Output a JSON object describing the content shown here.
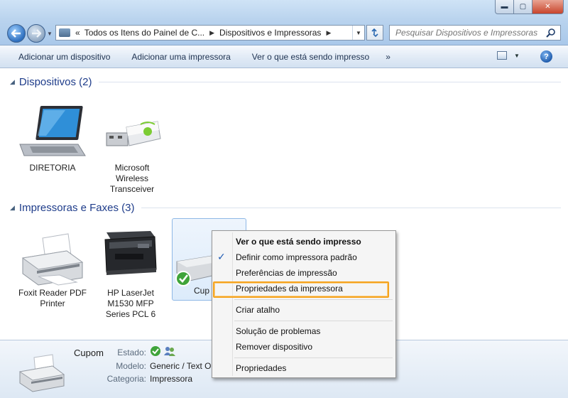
{
  "window": {
    "controls": {
      "minimize": "▬",
      "maximize": "▢",
      "close": "✕"
    }
  },
  "address_bar": {
    "prefix": "«",
    "crumbs": [
      "Todos os Itens do Painel de C...",
      "Dispositivos e Impressoras"
    ]
  },
  "search": {
    "placeholder": "Pesquisar Dispositivos e Impressoras"
  },
  "command_bar": {
    "items": [
      "Adicionar um dispositivo",
      "Adicionar uma impressora",
      "Ver o que está sendo impresso"
    ],
    "more": "»",
    "help": "?"
  },
  "groups": {
    "devices": {
      "title": "Dispositivos (2)"
    },
    "printers": {
      "title": "Impressoras e Faxes (3)"
    }
  },
  "devices": [
    {
      "label": "DIRETORIA",
      "icon": "laptop-icon"
    },
    {
      "label": "Microsoft Wireless Transceiver",
      "icon": "usb-transceiver-icon"
    }
  ],
  "printers": [
    {
      "label": "Foxit Reader PDF Printer",
      "icon": "printer-icon"
    },
    {
      "label": "HP LaserJet M1530 MFP Series PCL 6",
      "icon": "multifunction-printer-icon"
    },
    {
      "label": "Cupom",
      "icon": "printer-default-icon",
      "partial_label": "Cup"
    }
  ],
  "context_menu": {
    "items": [
      {
        "label": "Ver o que está sendo impresso",
        "bold": true
      },
      {
        "label": "Definir como impressora padrão",
        "checked": true
      },
      {
        "label": "Preferências de impressão"
      },
      {
        "label": "Propriedades da impressora",
        "highlighted": true
      },
      {
        "label": "Criar atalho"
      },
      {
        "label": "Solução de problemas"
      },
      {
        "label": "Remover dispositivo"
      },
      {
        "label": "Propriedades"
      }
    ],
    "check_mark": "✓"
  },
  "details": {
    "name": "Cupom",
    "labels": {
      "status": "Estado:",
      "model": "Modelo:",
      "category": "Categoria:"
    },
    "values": {
      "model": "Generic / Text O",
      "category": "Impressora"
    }
  },
  "colors": {
    "accent": "#f5a31e",
    "group_title": "#1e3c8a"
  }
}
